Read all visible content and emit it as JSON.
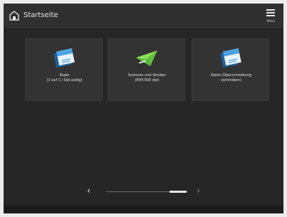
{
  "header": {
    "title": "Startseite",
    "menu_label": "Menü"
  },
  "tiles": [
    {
      "label_line1": "Kopie",
      "label_line2": "(2 auf 1 / Dpl.seitig)",
      "icon": "copy-icon"
    },
    {
      "label_line1": "Scannen und Senden",
      "label_line2": "(PDF/300 dpi)",
      "icon": "scan-send-icon"
    },
    {
      "label_line1": "Kopie (Überschreibung",
      "label_line2": "verhindern)",
      "icon": "copy-icon"
    }
  ],
  "pager": {
    "prev": "‹",
    "next": "›",
    "pages": 2,
    "current_page": 2
  },
  "colors": {
    "background": "#262626",
    "header": "#303030",
    "tile": "#333333",
    "accent_blue": "#4aa3e0",
    "accent_green": "#5fbf3a"
  }
}
